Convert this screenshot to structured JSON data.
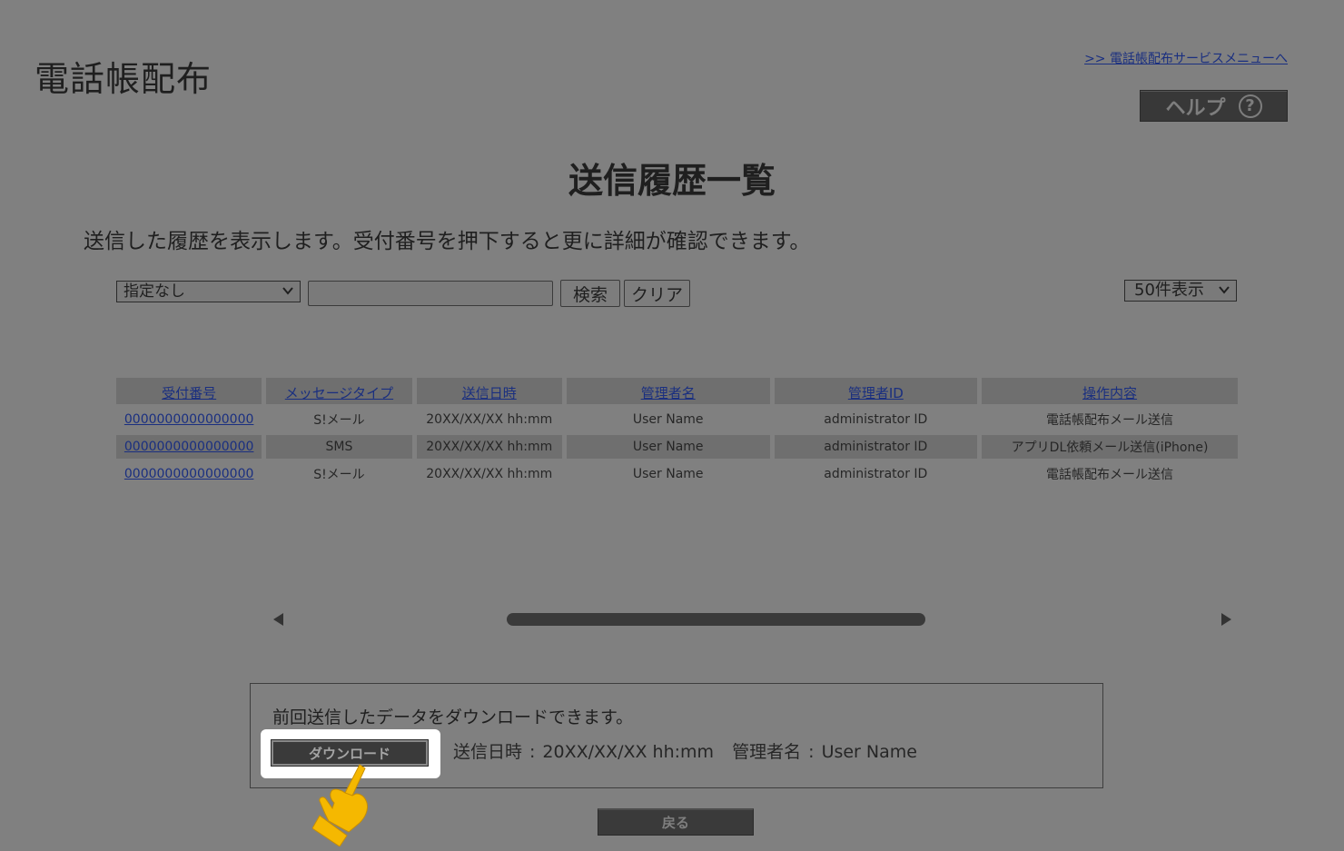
{
  "header": {
    "title": "電話帳配布",
    "menu_link": ">> 電話帳配布サービスメニューへ",
    "help_label": "ヘルプ",
    "help_icon_glyph": "?"
  },
  "main": {
    "section_title": "送信履歴一覧",
    "description": "送信した履歴を表示します。受付番号を押下すると更に詳細が確認できます。"
  },
  "filter": {
    "select_value": "指定なし",
    "search_value": "",
    "search_button": "検索",
    "clear_button": "クリア",
    "per_page_value": "50件表示"
  },
  "table": {
    "columns": [
      "受付番号",
      "メッセージタイプ",
      "送信日時",
      "管理者名",
      "管理者ID",
      "操作内容"
    ],
    "rows": [
      [
        "0000000000000000",
        "S!メール",
        "20XX/XX/XX hh:mm",
        "User Name",
        "administrator ID",
        "電話帳配布メール送信"
      ],
      [
        "0000000000000000",
        "SMS",
        "20XX/XX/XX hh:mm",
        "User Name",
        "administrator ID",
        "アプリDL依頼メール送信(iPhone)"
      ],
      [
        "0000000000000000",
        "S!メール",
        "20XX/XX/XX hh:mm",
        "User Name",
        "administrator ID",
        "電話帳配布メール送信"
      ]
    ]
  },
  "download": {
    "message": "前回送信したデータをダウンロードできます。",
    "button_label": "ダウンロード",
    "sent_label": "送信日時",
    "sent_value": "20XX/XX/XX hh:mm",
    "admin_label": "管理者名",
    "admin_value": "User Name"
  },
  "footer": {
    "back_label": "戻る"
  },
  "colors": {
    "background": "#808080",
    "link": "#1a2f80",
    "dark_button": "#3a3a3a",
    "pointer": "#f5b800"
  },
  "icons": {
    "pointer": "pointing-hand-icon",
    "help": "question-circle-icon",
    "dropdown": "chevron-down-icon"
  }
}
